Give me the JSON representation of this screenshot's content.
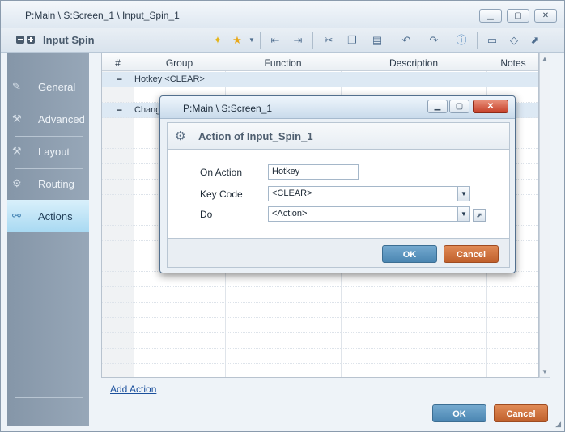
{
  "window": {
    "title": "P:Main \\ S:Screen_1 \\ Input_Spin_1"
  },
  "toolbar": {
    "title": "Input Spin"
  },
  "sidebar": {
    "items": [
      {
        "label": "General",
        "icon": "general-icon"
      },
      {
        "label": "Advanced",
        "icon": "wrench-icon"
      },
      {
        "label": "Layout",
        "icon": "layout-icon"
      },
      {
        "label": "Routing",
        "icon": "gear-icon"
      },
      {
        "label": "Actions",
        "icon": "actions-icon",
        "active": true
      }
    ]
  },
  "grid": {
    "columns": [
      "#",
      "Group",
      "Function",
      "Description",
      "Notes"
    ],
    "rows": [
      {
        "type": "group",
        "minus": "−",
        "text": "Hotkey <CLEAR>"
      },
      {
        "type": "group",
        "minus": "−",
        "text": "Change"
      }
    ]
  },
  "links": {
    "add_action": "Add Action"
  },
  "footer": {
    "ok": "OK",
    "cancel": "Cancel"
  },
  "dialog": {
    "title": "P:Main \\ S:Screen_1",
    "header": "Action of Input_Spin_1",
    "fields": {
      "on_action_label": "On Action",
      "on_action_value": "Hotkey",
      "key_code_label": "Key Code",
      "key_code_value": "<CLEAR>",
      "do_label": "Do",
      "do_value": "<Action>"
    },
    "ok": "OK",
    "cancel": "Cancel"
  }
}
